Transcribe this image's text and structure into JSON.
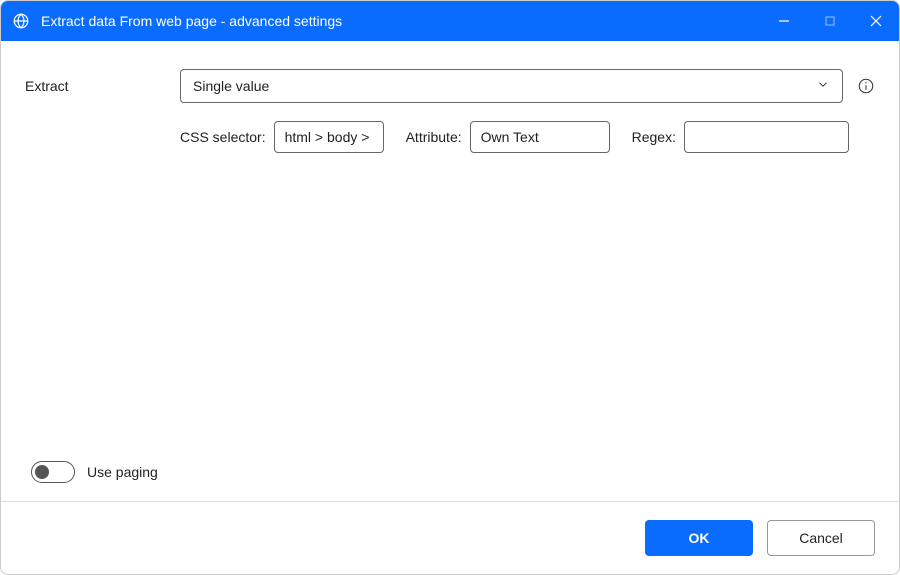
{
  "titlebar": {
    "title": "Extract data From web page - advanced settings"
  },
  "form": {
    "extract_label": "Extract",
    "extract_value": "Single value",
    "css_label": "CSS selector:",
    "css_value": "html > body >",
    "attr_label": "Attribute:",
    "attr_value": "Own Text",
    "regex_label": "Regex:",
    "regex_value": ""
  },
  "toggle": {
    "use_paging_label": "Use paging"
  },
  "footer": {
    "ok_label": "OK",
    "cancel_label": "Cancel"
  }
}
